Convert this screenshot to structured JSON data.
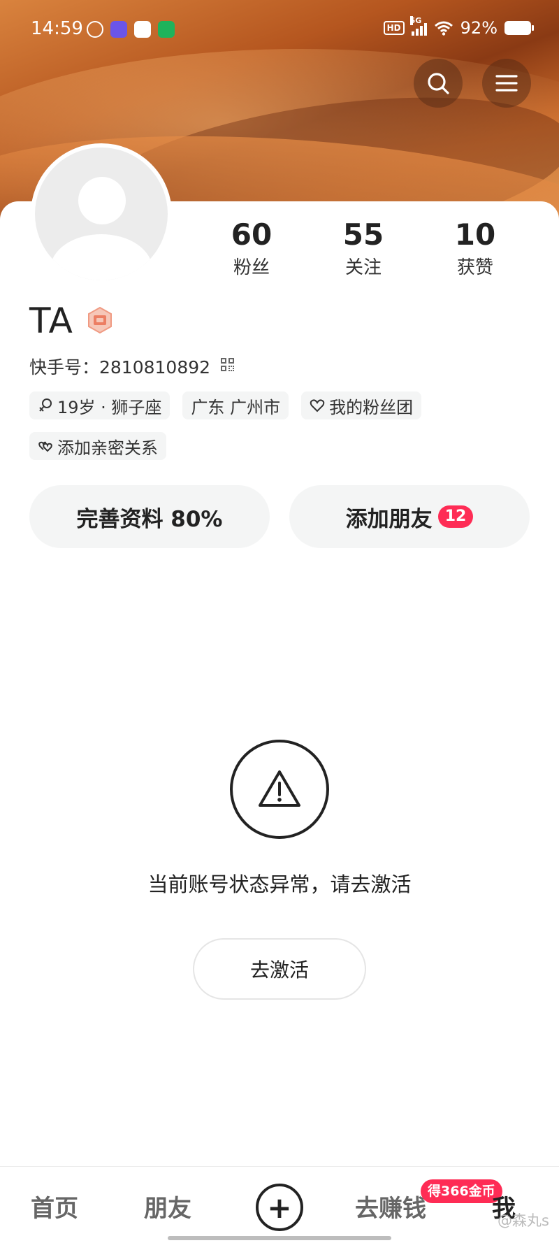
{
  "status_bar": {
    "time": "14:59",
    "hd_label": "HD",
    "network_label": "5G",
    "battery": "92%"
  },
  "profile": {
    "name": "TA",
    "uid_label": "快手号：2810810892",
    "stats": [
      {
        "value": "60",
        "label": "粉丝"
      },
      {
        "value": "55",
        "label": "关注"
      },
      {
        "value": "10",
        "label": "获赞"
      }
    ],
    "tags": [
      {
        "icon": "female-icon",
        "label": "19岁 · 狮子座"
      },
      {
        "icon": "",
        "label": "广东 广州市"
      },
      {
        "icon": "heart-icon",
        "label": "我的粉丝团"
      },
      {
        "icon": "link-hearts-icon",
        "label": "添加亲密关系"
      }
    ]
  },
  "actions": {
    "complete_profile": "完善资料 80%",
    "add_friends": "添加朋友",
    "friend_count": "12"
  },
  "notice": {
    "message": "当前账号状态异常，请去激活",
    "button": "去激活"
  },
  "nav": {
    "home": "首页",
    "friends": "朋友",
    "add": "+",
    "earn": "去赚钱",
    "coin_badge": "得366金币",
    "me": "我"
  },
  "watermark": "@森丸s",
  "colors": {
    "accent": "#fe2c55",
    "button_bg": "#f4f5f5"
  }
}
